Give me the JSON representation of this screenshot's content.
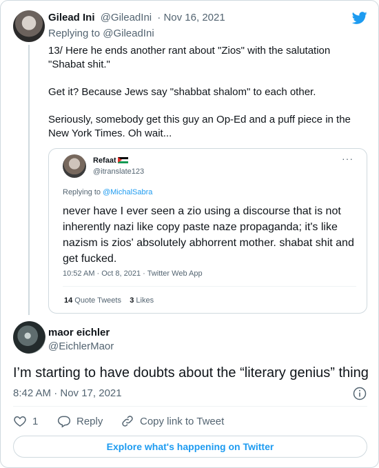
{
  "thread_tweet": {
    "author_name": "Gilead Ini",
    "author_handle": "@GileadIni",
    "date": "· Nov 16, 2021",
    "replying_prefix": "Replying to ",
    "replying_handle": "@GileadIni",
    "paragraphs": [
      "13/ Here he ends another rant about \"Zios\" with the salutation \"Shabat shit.\"",
      "Get it? Because Jews say \"shabbat shalom\" to each other.",
      "Seriously, somebody get this guy an Op-Ed and a puff piece in the New York Times. Oh wait..."
    ],
    "brand_icon": "twitter-bird-icon"
  },
  "quoted_tweet": {
    "author_name": "Refaat",
    "author_handle": "@itranslate123",
    "more_label": "···",
    "replying_prefix": "Replying to ",
    "replying_handle": "@MichalSabra",
    "text": "never have I ever seen a zio using a discourse that is not inherently nazi like copy paste naze propaganda; it's like nazism is zios' absolutely abhorrent mother. shabat shit and get fucked.",
    "meta": "10:52 AM · Oct 8, 2021 · Twitter Web App",
    "quote_tweets_count": "14",
    "quote_tweets_label": " Quote Tweets",
    "likes_count": "3",
    "likes_label": " Likes"
  },
  "main_tweet": {
    "author_name": "maor eichler",
    "author_handle": "@EichlerMaor",
    "text": "I’m starting to have doubts about the “literary genius” thing",
    "timestamp": "8:42 AM · Nov 17, 2021"
  },
  "actions": {
    "like_count": "1",
    "reply_label": "Reply",
    "copy_link_label": "Copy link to Tweet"
  },
  "explore_label": "Explore what's happening on Twitter",
  "colors": {
    "accent": "#1d9bf0",
    "text": "#0f1419",
    "secondary": "#536471",
    "border": "#cfd9de"
  }
}
